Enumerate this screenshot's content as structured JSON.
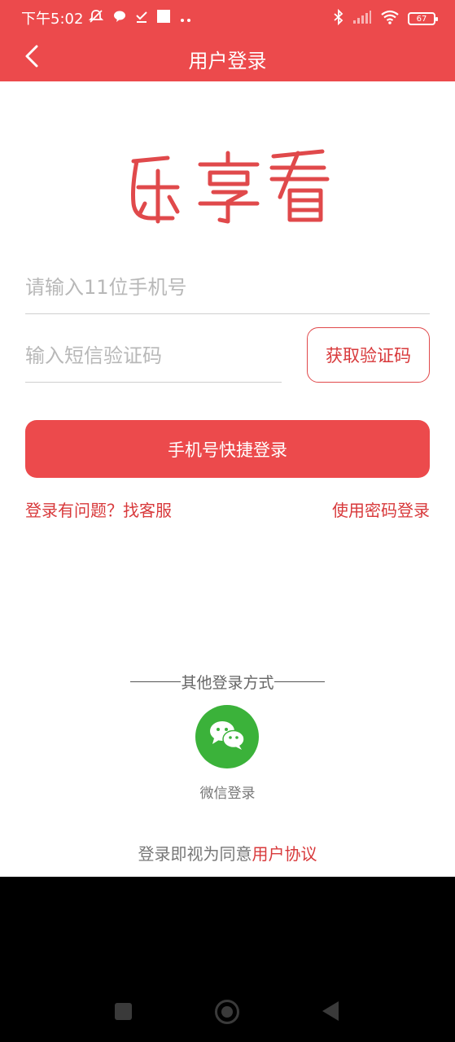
{
  "status_bar": {
    "time": "下午5:02",
    "battery": "67",
    "icons": [
      "mute-icon",
      "chat-icon",
      "check-icon",
      "square-icon",
      "more-dots-icon",
      "bluetooth-icon",
      "signal-icon",
      "wifi-icon",
      "battery-icon"
    ]
  },
  "app_bar": {
    "title": "用户登录",
    "back_icon": "chevron-left-icon"
  },
  "logo": {
    "text": "乐享看",
    "color": "#e0494b"
  },
  "form": {
    "phone_placeholder": "请输入11位手机号",
    "code_placeholder": "输入短信验证码",
    "get_code_label": "获取验证码",
    "login_label": "手机号快捷登录"
  },
  "links": {
    "help": "登录有问题？找客服",
    "password_login": "使用密码登录"
  },
  "other_login": {
    "divider_text": "其他登录方式",
    "wechat_label": "微信登录",
    "wechat_icon": "wechat-icon"
  },
  "agreement": {
    "prefix": "登录即视为同意",
    "link": "用户协议"
  },
  "colors": {
    "brand": "#ec4a4c",
    "accent_text": "#d8393b",
    "wechat": "#3bb23a"
  }
}
